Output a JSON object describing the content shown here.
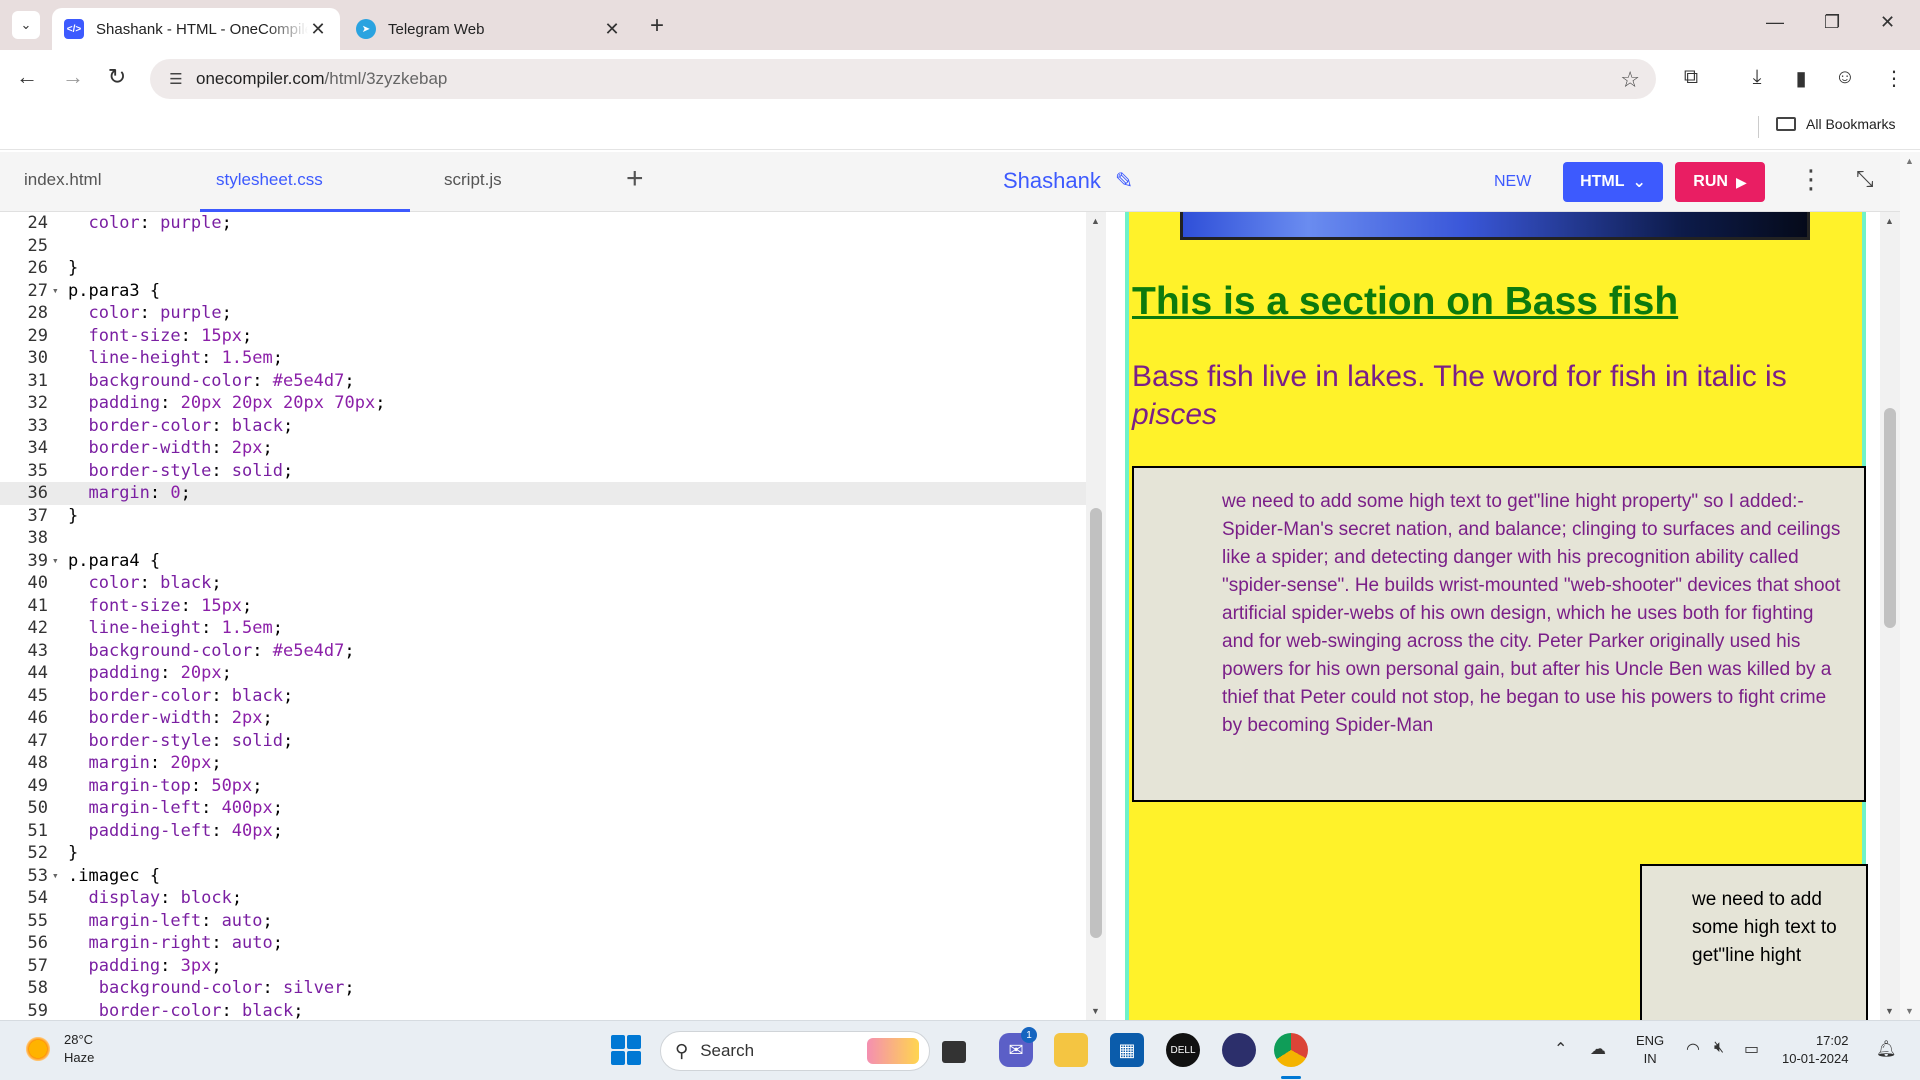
{
  "browser": {
    "tabs": [
      {
        "title": "Shashank - HTML - OneCompiler",
        "close": "✕"
      },
      {
        "title": "Telegram Web",
        "close": "✕"
      }
    ],
    "new_tab": "+",
    "window_controls": {
      "minimize": "—",
      "restore": "❐",
      "close": "✕"
    },
    "url_host": "onecompiler.com",
    "url_path": "/html/3zyzkebap",
    "bookmarks_label": "All Bookmarks"
  },
  "app": {
    "file_tabs": [
      "index.html",
      "stylesheet.css",
      "script.js"
    ],
    "add_file": "+",
    "project_name": "Shashank",
    "new_label": "NEW",
    "language_label": "HTML",
    "run_label": "RUN"
  },
  "editor": {
    "current_line": 36,
    "lines": [
      {
        "n": "24",
        "fold": "",
        "code": "  color: purple;"
      },
      {
        "n": "25",
        "fold": "",
        "code": ""
      },
      {
        "n": "26",
        "fold": "",
        "code": "}"
      },
      {
        "n": "27",
        "fold": "▾",
        "code": "p.para3 {"
      },
      {
        "n": "28",
        "fold": "",
        "code": "  color: purple;"
      },
      {
        "n": "29",
        "fold": "",
        "code": "  font-size: 15px;"
      },
      {
        "n": "30",
        "fold": "",
        "code": "  line-height: 1.5em;"
      },
      {
        "n": "31",
        "fold": "",
        "code": "  background-color: #e5e4d7;"
      },
      {
        "n": "32",
        "fold": "",
        "code": "  padding: 20px 20px 20px 70px;"
      },
      {
        "n": "33",
        "fold": "",
        "code": "  border-color: black;"
      },
      {
        "n": "34",
        "fold": "",
        "code": "  border-width: 2px;"
      },
      {
        "n": "35",
        "fold": "",
        "code": "  border-style: solid;"
      },
      {
        "n": "36",
        "fold": "",
        "code": "  margin: 0;"
      },
      {
        "n": "37",
        "fold": "",
        "code": "}"
      },
      {
        "n": "38",
        "fold": "",
        "code": ""
      },
      {
        "n": "39",
        "fold": "▾",
        "code": "p.para4 {"
      },
      {
        "n": "40",
        "fold": "",
        "code": "  color: black;"
      },
      {
        "n": "41",
        "fold": "",
        "code": "  font-size: 15px;"
      },
      {
        "n": "42",
        "fold": "",
        "code": "  line-height: 1.5em;"
      },
      {
        "n": "43",
        "fold": "",
        "code": "  background-color: #e5e4d7;"
      },
      {
        "n": "44",
        "fold": "",
        "code": "  padding: 20px;"
      },
      {
        "n": "45",
        "fold": "",
        "code": "  border-color: black;"
      },
      {
        "n": "46",
        "fold": "",
        "code": "  border-width: 2px;"
      },
      {
        "n": "47",
        "fold": "",
        "code": "  border-style: solid;"
      },
      {
        "n": "48",
        "fold": "",
        "code": "  margin: 20px;"
      },
      {
        "n": "49",
        "fold": "",
        "code": "  margin-top: 50px;"
      },
      {
        "n": "50",
        "fold": "",
        "code": "  margin-left: 400px;"
      },
      {
        "n": "51",
        "fold": "",
        "code": "  padding-left: 40px;"
      },
      {
        "n": "52",
        "fold": "",
        "code": "}"
      },
      {
        "n": "53",
        "fold": "▾",
        "code": ".imagec {"
      },
      {
        "n": "54",
        "fold": "",
        "code": "  display: block;"
      },
      {
        "n": "55",
        "fold": "",
        "code": "  margin-left: auto;"
      },
      {
        "n": "56",
        "fold": "",
        "code": "  margin-right: auto;"
      },
      {
        "n": "57",
        "fold": "",
        "code": "  padding: 3px;"
      },
      {
        "n": "58",
        "fold": "",
        "code": "   background-color: silver;"
      },
      {
        "n": "59",
        "fold": "",
        "code": "   border-color: black;"
      }
    ]
  },
  "preview": {
    "heading": "This is a section on Bass fish",
    "para1_text": "Bass fish live in lakes. The word for fish in italic is ",
    "para1_italic": "pisces",
    "para3": "we need to add some high text to get\"line hight property\" so I added:-Spider-Man's secret nation, and balance; clinging to surfaces and ceilings like a spider; and detecting danger with his precognition ability called \"spider-sense\". He builds wrist-mounted \"web-shooter\" devices that shoot artificial spider-webs of his own design, which he uses both for fighting and for web-swinging across the city. Peter Parker originally used his powers for his own personal gain, but after his Uncle Ben was killed by a thief that Peter could not stop, he began to use his powers to fight crime by becoming Spider-Man",
    "para4": "we need to add some high text to get\"line hight",
    "colors": {
      "page_bg": "#fff22a",
      "heading": "#0d7a0d",
      "para": "#7a1f88",
      "box_bg": "#e5e4d7"
    }
  },
  "taskbar": {
    "temperature": "28°C",
    "weather": "Haze",
    "search_label": "Search",
    "chat_badge": "1",
    "lang_top": "ENG",
    "lang_bottom": "IN",
    "time": "17:02",
    "date": "10-01-2024"
  },
  "icons": [
    "tab-list-icon",
    "back-icon",
    "forward-icon",
    "reload-icon",
    "site-info-icon",
    "bookmark-star-icon",
    "extensions-icon",
    "download-icon",
    "sidepanel-icon",
    "profile-icon",
    "menu-icon",
    "folder-icon",
    "pencil-icon",
    "chevron-down-icon",
    "play-icon",
    "kebab-icon",
    "collapse-icon"
  ]
}
